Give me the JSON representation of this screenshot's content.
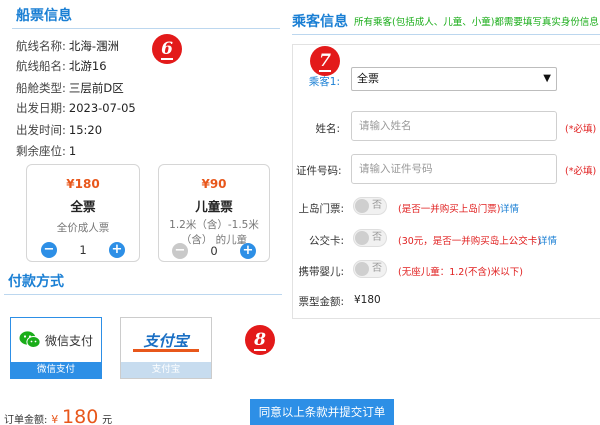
{
  "ticket": {
    "section_title": "船票信息",
    "rows": [
      {
        "label": "航线名称:",
        "value": "北海-涠洲"
      },
      {
        "label": "航线船名:",
        "value": "北游16"
      },
      {
        "label": "船舱类型:",
        "value": "三层前D区"
      },
      {
        "label": "出发日期:",
        "value": "2023-07-05"
      },
      {
        "label": "出发时间:",
        "value": "15:20"
      },
      {
        "label": "剩余座位:",
        "value": "1"
      }
    ],
    "adult": {
      "price": "¥180",
      "title": "全票",
      "desc": "全价成人票",
      "qty": "1"
    },
    "child": {
      "price": "¥90",
      "title": "儿童票",
      "desc_line1": "1.2米（含）-1.5米",
      "desc_line2": "（含） 的儿童",
      "qty": "0"
    }
  },
  "badges": {
    "b6": "6",
    "b7": "7",
    "b8": "8"
  },
  "passenger": {
    "section_title": "乘客信息",
    "subtitle": "所有乘客(包括成人、儿童、小童)都需要填写真实身份信息",
    "passenger_label": "乘客1:",
    "ticket_type_value": "全票",
    "name_label": "姓名:",
    "name_placeholder": "请输入姓名",
    "required": "(*必填)",
    "id_label": "证件号码:",
    "id_placeholder": "请输入证件号码",
    "island_label": "上岛门票:",
    "island_note": "(是否一并购买上岛门票)",
    "bus_label": "公交卡:",
    "bus_note": "(30元，是否一并购买岛上公交卡)",
    "infant_label": "携带婴儿:",
    "infant_note": "(无座儿童：1.2(不含)米以下)",
    "toggle_off": "否",
    "detail": "详情",
    "total_label": "票型金额:",
    "total_value": "¥180"
  },
  "payment": {
    "section_title": "付款方式",
    "wechat_text": "微信支付",
    "wechat_caption": "微信支付",
    "alipay_logo": "支付宝",
    "alipay_caption": "支付宝",
    "order_label": "订单金额:",
    "order_currency": "¥",
    "order_amount": "180",
    "order_unit": "元",
    "submit": "同意以上条款并提交订单"
  },
  "colors": {
    "accent": "#2d8fe6",
    "price": "#e8571b",
    "required": "#e02020",
    "wechat": "#1aad19"
  }
}
